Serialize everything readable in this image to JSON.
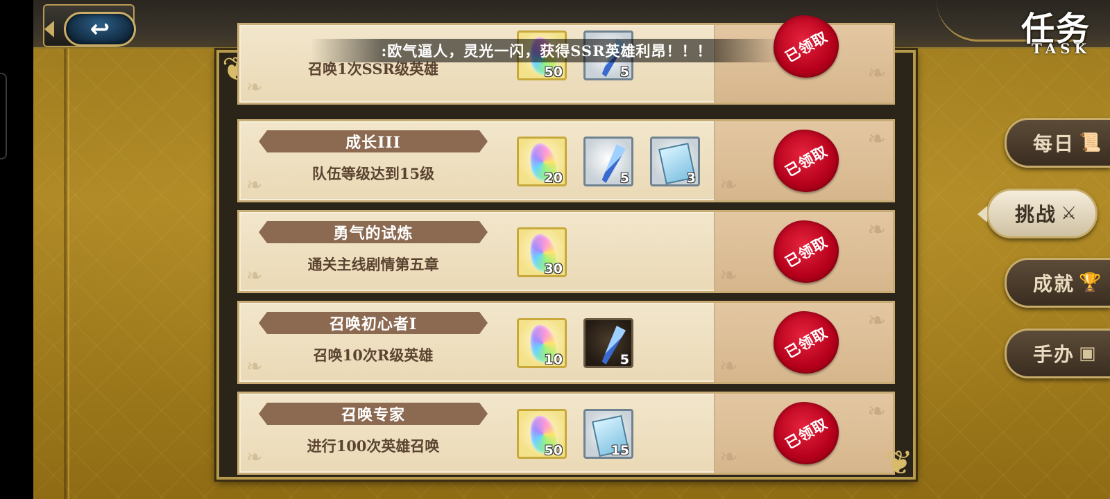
{
  "header": {
    "title_zh": "任务",
    "title_en": "TASK",
    "back_icon": "back-arrow-icon",
    "marquee": ":欧气逼人，灵光一闪，获得SSR英雄利昂！！！"
  },
  "claim_label": "已领取",
  "tasks": [
    {
      "title": "",
      "desc": "召唤1次SSR级英雄",
      "rewards": [
        {
          "icon": "gem-icon",
          "frame": "gold",
          "qty": "50"
        },
        {
          "icon": "dagger-icon",
          "frame": "silver",
          "qty": "5"
        }
      ]
    },
    {
      "title": "成长III",
      "desc": "队伍等级达到15级",
      "rewards": [
        {
          "icon": "gem-icon",
          "frame": "gold",
          "qty": "20"
        },
        {
          "icon": "dagger-icon",
          "frame": "silver",
          "qty": "5"
        },
        {
          "icon": "ticket-icon",
          "frame": "silver",
          "qty": "3"
        }
      ]
    },
    {
      "title": "勇气的试炼",
      "desc": "通关主线剧情第五章",
      "rewards": [
        {
          "icon": "gem-icon",
          "frame": "gold",
          "qty": "30"
        }
      ]
    },
    {
      "title": "召唤初心者I",
      "desc": "召唤10次R级英雄",
      "rewards": [
        {
          "icon": "gem-icon",
          "frame": "gold",
          "qty": "10"
        },
        {
          "icon": "dagger-icon",
          "frame": "dark",
          "qty": "5"
        }
      ]
    },
    {
      "title": "召唤专家",
      "desc": "进行100次英雄召唤",
      "rewards": [
        {
          "icon": "gem-icon",
          "frame": "gold",
          "qty": "50"
        },
        {
          "icon": "ticket-icon",
          "frame": "silver",
          "qty": "15"
        }
      ]
    }
  ],
  "side_tabs": [
    {
      "label": "每日",
      "icon": "scroll-icon",
      "active": false
    },
    {
      "label": "挑战",
      "icon": "crossed-swords-icon",
      "active": true
    },
    {
      "label": "成就",
      "icon": "trophy-icon",
      "active": false
    },
    {
      "label": "手办",
      "icon": "figure-card-icon",
      "active": false
    }
  ],
  "colors": {
    "seal_red": "#c8102e",
    "banner_brown": "#8c6a52",
    "gold_frame": "#c7a83c",
    "background_gold": "#a8841f"
  }
}
